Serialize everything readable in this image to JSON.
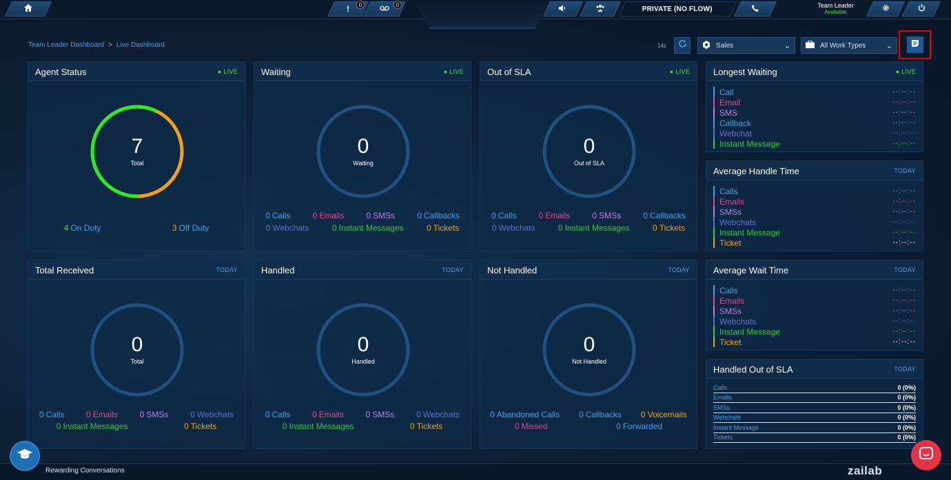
{
  "topbar": {
    "alerts_count": "0",
    "voicemail_count": "0",
    "status": "PRIVATE (NO FLOW)",
    "user_role": "Team Leader",
    "user_status": "Available"
  },
  "breadcrumb": {
    "parent": "Team Leader Dashboard",
    "separator": ">",
    "current": "Live Dashboard"
  },
  "controls": {
    "timer": "14s",
    "queue_select": "Sales",
    "worktype_select": "All Work Types"
  },
  "colors": {
    "accent": "#3aa3ec",
    "live": "#44e03a",
    "on_duty": "#2ee82a",
    "off_duty": "#f2a20f",
    "emails": "#e2488e",
    "sms": "#c37cf0",
    "webchats": "#5b6fd6",
    "instant": "#2dcc39",
    "tickets": "#f2a20f",
    "calls": "#3aa3ec"
  },
  "agent_status": {
    "title": "Agent Status",
    "tag": "LIVE",
    "value": "7",
    "label": "Total",
    "on_duty_num": "4",
    "on_duty_label": "On Duty",
    "off_duty_num": "3",
    "off_duty_label": "Off Duty",
    "on_duty_fraction": 0.571
  },
  "waiting": {
    "title": "Waiting",
    "tag": "LIVE",
    "value": "0",
    "label": "Waiting",
    "row1": [
      {
        "num": "0",
        "label": "Calls",
        "color": "#3aa3ec"
      },
      {
        "num": "0",
        "label": "Emails",
        "color": "#e2488e"
      },
      {
        "num": "0",
        "label": "SMSs",
        "color": "#c37cf0"
      },
      {
        "num": "0",
        "label": "Callbacks",
        "color": "#3aa3ec"
      }
    ],
    "row2": [
      {
        "num": "0",
        "label": "Webchats",
        "color": "#5b6fd6"
      },
      {
        "num": "0",
        "label": "Instant Messages",
        "color": "#2dcc39"
      },
      {
        "num": "0",
        "label": "Tickets",
        "color": "#f2a20f"
      }
    ]
  },
  "out_of_sla": {
    "title": "Out of SLA",
    "tag": "LIVE",
    "value": "0",
    "label": "Out of SLA",
    "row1": [
      {
        "num": "0",
        "label": "Calls",
        "color": "#3aa3ec"
      },
      {
        "num": "0",
        "label": "Emails",
        "color": "#e2488e"
      },
      {
        "num": "0",
        "label": "SMSs",
        "color": "#c37cf0"
      },
      {
        "num": "0",
        "label": "Callbacks",
        "color": "#3aa3ec"
      }
    ],
    "row2": [
      {
        "num": "0",
        "label": "Webchats",
        "color": "#5b6fd6"
      },
      {
        "num": "0",
        "label": "Instant Messages",
        "color": "#2dcc39"
      },
      {
        "num": "0",
        "label": "Tickets",
        "color": "#f2a20f"
      }
    ]
  },
  "total_received": {
    "title": "Total Received",
    "tag": "TODAY",
    "value": "0",
    "label": "Total",
    "row1": [
      {
        "num": "0",
        "label": "Calls",
        "color": "#3aa3ec"
      },
      {
        "num": "0",
        "label": "Emails",
        "color": "#e2488e"
      },
      {
        "num": "0",
        "label": "SMSs",
        "color": "#c37cf0"
      },
      {
        "num": "0",
        "label": "Webchats",
        "color": "#5b6fd6"
      }
    ],
    "row2": [
      {
        "num": "0",
        "label": "Instant Messages",
        "color": "#2dcc39"
      },
      {
        "num": "0",
        "label": "Tickets",
        "color": "#f2a20f"
      }
    ]
  },
  "handled": {
    "title": "Handled",
    "tag": "TODAY",
    "value": "0",
    "label": "Handled",
    "row1": [
      {
        "num": "0",
        "label": "Calls",
        "color": "#3aa3ec"
      },
      {
        "num": "0",
        "label": "Emails",
        "color": "#e2488e"
      },
      {
        "num": "0",
        "label": "SMSs",
        "color": "#c37cf0"
      },
      {
        "num": "0",
        "label": "Webchats",
        "color": "#5b6fd6"
      }
    ],
    "row2": [
      {
        "num": "0",
        "label": "Instant Messages",
        "color": "#2dcc39"
      },
      {
        "num": "0",
        "label": "Tickets",
        "color": "#f2a20f"
      }
    ]
  },
  "not_handled": {
    "title": "Not Handled",
    "tag": "TODAY",
    "value": "0",
    "label": "Not Handled",
    "row1": [
      {
        "num": "0",
        "label": "Abandoned Calls",
        "color": "#3aa3ec"
      },
      {
        "num": "0",
        "label": "Callbacks",
        "color": "#3aa3ec"
      },
      {
        "num": "0",
        "label": "Voicemails",
        "color": "#f2a20f"
      }
    ],
    "row2": [
      {
        "num": "0",
        "label": "Missed",
        "color": "#e2488e"
      },
      {
        "num": "0",
        "label": "Forwarded",
        "color": "#3aa3ec"
      }
    ]
  },
  "longest_waiting": {
    "title": "Longest Waiting",
    "tag": "LIVE",
    "items": [
      {
        "label": "Call",
        "value": "--:--:--",
        "color": "#3aa3ec"
      },
      {
        "label": "Email",
        "value": "--:--:--",
        "color": "#e2488e"
      },
      {
        "label": "SMS",
        "value": "--:--:--",
        "color": "#c37cf0"
      },
      {
        "label": "Callback",
        "value": "--:--:--",
        "color": "#3aa3ec"
      },
      {
        "label": "Webchat",
        "value": "--:--:--",
        "color": "#5b6fd6"
      },
      {
        "label": "Instant Message",
        "value": "--:--:--",
        "color": "#2dcc39"
      }
    ]
  },
  "average_handle_time": {
    "title": "Average Handle Time",
    "tag": "TODAY",
    "items": [
      {
        "label": "Calls",
        "value": "--:--:--",
        "color": "#3aa3ec"
      },
      {
        "label": "Emails",
        "value": "--:--:--",
        "color": "#e2488e"
      },
      {
        "label": "SMSs",
        "value": "--:--:--",
        "color": "#c37cf0"
      },
      {
        "label": "Webchats",
        "value": "--:--:--",
        "color": "#5b6fd6"
      },
      {
        "label": "Instant Message",
        "value": "--:--:--",
        "color": "#2dcc39"
      },
      {
        "label": "Ticket",
        "value": "--:--:--",
        "color": "#f2a20f"
      }
    ]
  },
  "average_wait_time": {
    "title": "Average Wait Time",
    "tag": "TODAY",
    "items": [
      {
        "label": "Calls",
        "value": "--:--:--",
        "color": "#3aa3ec"
      },
      {
        "label": "Emails",
        "value": "--:--:--",
        "color": "#e2488e"
      },
      {
        "label": "SMSs",
        "value": "--:--:--",
        "color": "#c37cf0"
      },
      {
        "label": "Webchats",
        "value": "--:--:--",
        "color": "#5b6fd6"
      },
      {
        "label": "Instant Message",
        "value": "--:--:--",
        "color": "#2dcc39"
      },
      {
        "label": "Ticket",
        "value": "--:--:--",
        "color": "#f2a20f"
      }
    ]
  },
  "handled_out_of_sla": {
    "title": "Handled Out of SLA",
    "tag": "TODAY",
    "items": [
      {
        "label": "Calls",
        "value": "0 (0%)"
      },
      {
        "label": "Emails",
        "value": "0 (0%)"
      },
      {
        "label": "SMSs",
        "value": "0 (0%)"
      },
      {
        "label": "Webchats",
        "value": "0 (0%)"
      },
      {
        "label": "Instant Message",
        "value": "0 (0%)"
      },
      {
        "label": "Tickets",
        "value": "0 (0%)"
      }
    ]
  },
  "footer": {
    "tagline": "Rewarding Conversations",
    "logo": "zailab"
  }
}
